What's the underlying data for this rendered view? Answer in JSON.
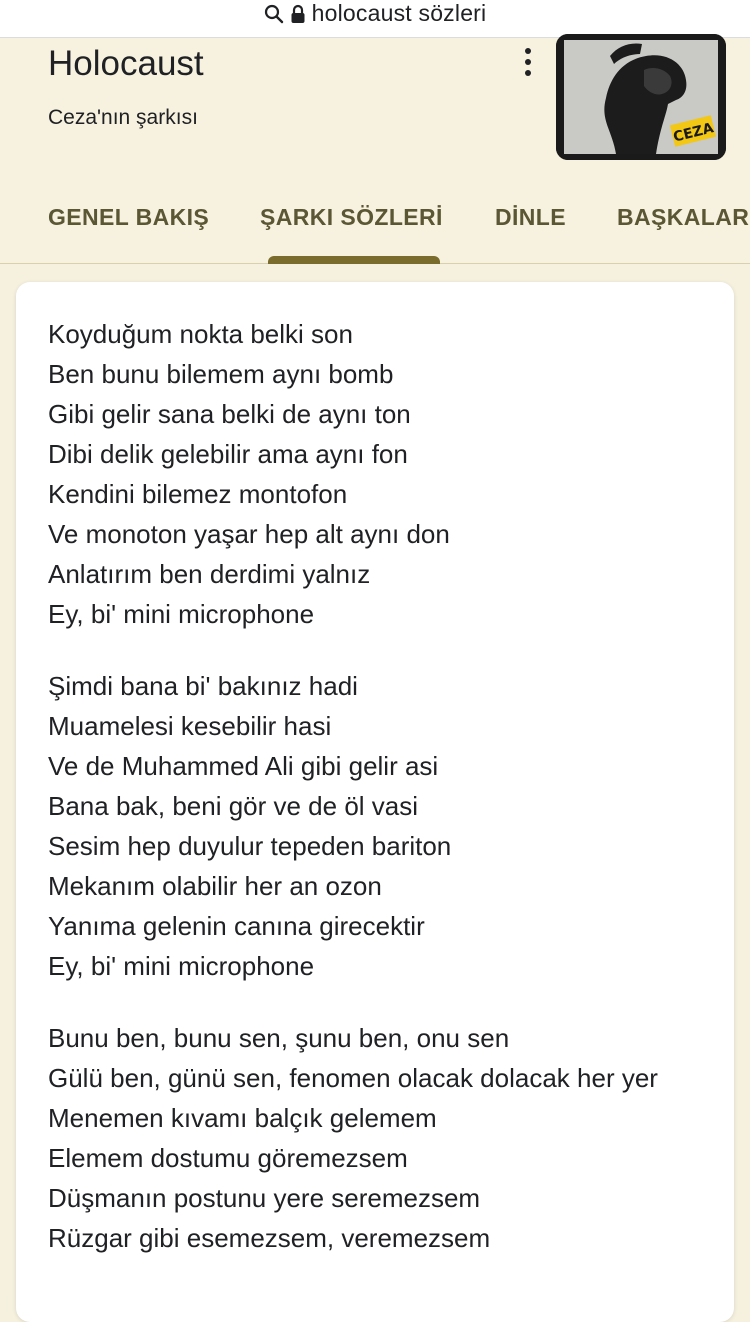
{
  "browser": {
    "url_text": "holocaust sözleri"
  },
  "song": {
    "title": "Holocaust",
    "subtitle": "Ceza'nın şarkısı",
    "album_art_text": "CEZA"
  },
  "tabs": [
    {
      "label": "GENEL BAKIŞ",
      "selected": false
    },
    {
      "label": "ŞARKI SÖZLERİ",
      "selected": true
    },
    {
      "label": "DİNLE",
      "selected": false
    },
    {
      "label": "BAŞKALAR",
      "selected": false
    }
  ],
  "lyrics": {
    "stanzas": [
      {
        "lines": [
          "Koyduğum nokta belki son",
          "Ben bunu bilemem aynı bomb",
          "Gibi gelir sana belki de aynı ton",
          "Dibi delik gelebilir ama aynı fon",
          "Kendini bilemez montofon",
          "Ve monoton yaşar hep alt aynı don",
          "Anlatırım ben derdimi yalnız",
          "Ey, bi' mini microphone"
        ]
      },
      {
        "lines": [
          "Şimdi bana bi' bakınız hadi",
          "Muamelesi kesebilir hasi",
          "Ve de Muhammed Ali gibi gelir asi",
          "Bana bak, beni gör ve de öl vasi",
          "Sesim hep duyulur tepeden bariton",
          "Mekanım olabilir her an ozon",
          "Yanıma gelenin canına girecektir",
          "Ey, bi' mini microphone"
        ]
      },
      {
        "lines": [
          "Bunu ben, bunu sen, şunu ben, onu sen",
          "Gülü ben, günü sen, fenomen olacak dolacak her yer",
          "Menemen kıvamı balçık gelemem",
          "Elemem dostumu göremezsem",
          "Düşmanın postunu yere seremezsem",
          "Rüzgar gibi esemezsem, veremezsem"
        ]
      }
    ]
  },
  "colors": {
    "header_bg": "#f7f2df",
    "tab_text": "#5b5634",
    "tab_indicator": "#7a6c2c",
    "card_bg": "#ffffff",
    "album_accent": "#f2c814"
  },
  "icons": {
    "url_bar": [
      "search-icon",
      "lock-icon"
    ],
    "header": [
      "more-vert-icon"
    ]
  }
}
